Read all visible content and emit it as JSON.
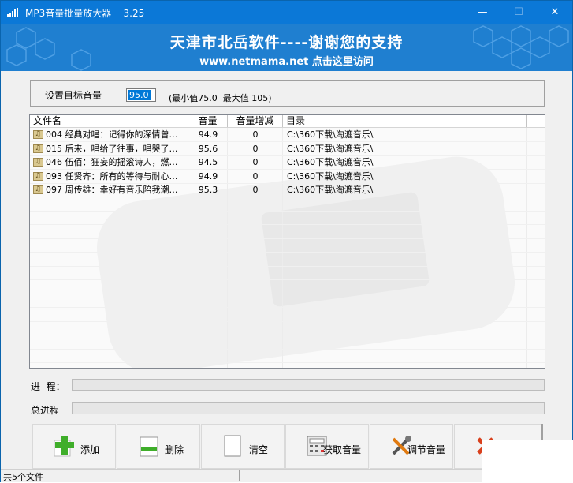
{
  "window": {
    "title": "MP3音量批量放大器",
    "version": "3.25",
    "controls": {
      "minimize": "—",
      "maximize": "☐",
      "close": "✕"
    }
  },
  "banner": {
    "line1": "天津市北岳软件----谢谢您的支持",
    "line2": "www.netmama.net   点击这里访问"
  },
  "settings": {
    "label": "设置目标音量",
    "value": "95.0",
    "hint": "(最小值75.0  最大值 105)"
  },
  "file_list": {
    "columns": [
      "文件名",
      "音量",
      "音量增减",
      "目录"
    ],
    "rows": [
      {
        "name": "004 经典对唱：记得你的深情曾…",
        "volume": "94.9",
        "delta": "0",
        "dir": "C:\\360下载\\淘漉音乐\\"
      },
      {
        "name": "015 后来，唱给了往事，唱哭了…",
        "volume": "95.6",
        "delta": "0",
        "dir": "C:\\360下载\\淘漉音乐\\"
      },
      {
        "name": "046 伍佰：狂妄的摇滚诗人，燃…",
        "volume": "94.5",
        "delta": "0",
        "dir": "C:\\360下载\\淘漉音乐\\"
      },
      {
        "name": "093 任贤齐：所有的等待与耐心…",
        "volume": "94.9",
        "delta": "0",
        "dir": "C:\\360下载\\淘漉音乐\\"
      },
      {
        "name": "097 周传雄：幸好有音乐陪我潮…",
        "volume": "95.3",
        "delta": "0",
        "dir": "C:\\360下载\\淘漉音乐\\"
      }
    ]
  },
  "progress": {
    "label": "进  程：",
    "value": 0
  },
  "total_progress": {
    "label": "总进程",
    "value": 0
  },
  "toolbar": {
    "add": "添加",
    "delete": "删除",
    "clear": "清空",
    "get_volume": "获取音量",
    "adjust_volume": "调节音量"
  },
  "status": {
    "text": "共5个文件"
  },
  "colors": {
    "title_bar": "#0b78d7",
    "banner": "#1f7fd0",
    "selection": "#0078d7"
  }
}
